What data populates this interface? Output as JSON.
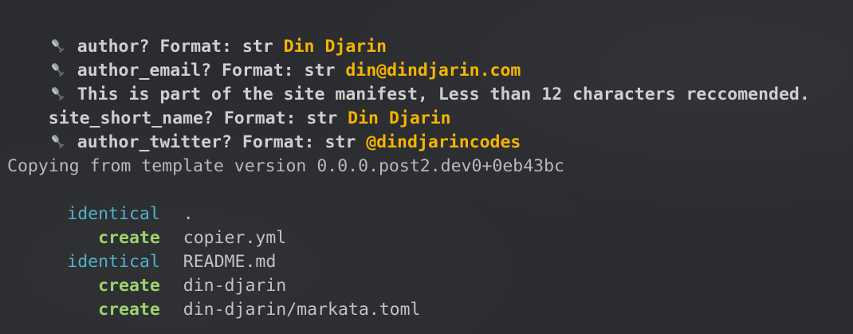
{
  "questions": [
    {
      "show_icon": true,
      "prompt": "author? Format: str ",
      "answer": "Din Djarin"
    },
    {
      "show_icon": true,
      "prompt": "author_email? Format: str ",
      "answer": "din@dindjarin.com"
    },
    {
      "show_icon": true,
      "prompt": "This is part of the site manifest, Less than 12 characters reccomended.",
      "answer": ""
    },
    {
      "show_icon": false,
      "prompt": "site_short_name? Format: str ",
      "answer": "Din Djarin"
    },
    {
      "show_icon": true,
      "prompt": "author_twitter? Format: str ",
      "answer": "@dindjarincodes"
    }
  ],
  "copy_header": "Copying from template version 0.0.0.post2.dev0+0eb43bc",
  "actions": [
    {
      "action": "identical",
      "path": "."
    },
    {
      "action": "create",
      "path": "copier.yml"
    },
    {
      "action": "identical",
      "path": "README.md"
    },
    {
      "action": "create",
      "path": "din-djarin"
    },
    {
      "action": "create",
      "path": "din-djarin/markata.toml"
    }
  ],
  "icon": "microphone-icon",
  "colors": {
    "background": "#2a2c30",
    "answer": "#f5b400",
    "identical": "#4fb3c8",
    "create": "#9ed36a"
  }
}
